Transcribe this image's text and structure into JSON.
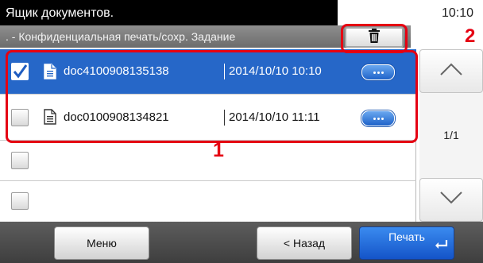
{
  "header": {
    "title": "Ящик документов.",
    "clock": "10:10",
    "subtitle": ". - Конфиденциальная печать/сохр. Задание"
  },
  "icons": {
    "trash": "trash-icon",
    "document": "document-icon",
    "detail": "more-details-icon",
    "scroll_up": "chevron-up-icon",
    "scroll_down": "chevron-down-icon",
    "enter": "enter-arrow-icon"
  },
  "list": {
    "rows": [
      {
        "name": "doc4100908135138",
        "date": "2014/10/10 10:10",
        "checked": true
      },
      {
        "name": "doc0100908134821",
        "date": "2014/10/10 11:11",
        "checked": false
      },
      {
        "name": "",
        "date": "",
        "checked": false
      },
      {
        "name": "",
        "date": "",
        "checked": false
      }
    ]
  },
  "pagination": {
    "indicator": "1/1"
  },
  "callouts": {
    "list_label": "1",
    "trash_label": "2",
    "color": "#e50012"
  },
  "bottom": {
    "menu_label": "Меню",
    "back_label": "< Назад",
    "print_label": "Печать"
  },
  "colors": {
    "selected_row": "#2667c8",
    "print_button": "#1f6fe0"
  }
}
